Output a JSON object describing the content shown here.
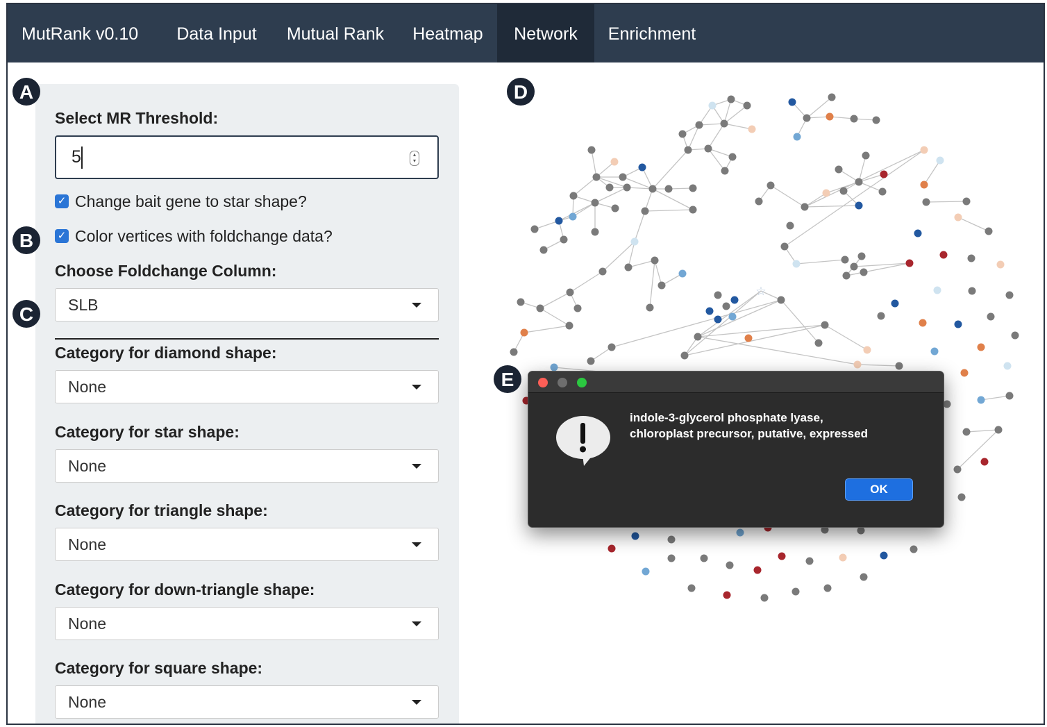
{
  "navbar": {
    "brand": "MutRank v0.10",
    "items": [
      "Data Input",
      "Mutual Rank",
      "Heatmap",
      "Network",
      "Enrichment"
    ],
    "active": "Network"
  },
  "sidebar": {
    "threshold_label": "Select MR Threshold:",
    "threshold_value": "5",
    "checkbox_star": {
      "label": "Change bait gene to star shape?",
      "checked": true
    },
    "checkbox_color": {
      "label": "Color vertices with foldchange data?",
      "checked": true
    },
    "foldchange_label": "Choose Foldchange Column:",
    "foldchange_value": "SLB",
    "diamond_label": "Category for diamond shape:",
    "diamond_value": "None",
    "star_label": "Category for star shape:",
    "star_value": "None",
    "triangle_label": "Category for triangle shape:",
    "triangle_value": "None",
    "downtriangle_label": "Category for down-triangle shape:",
    "downtriangle_value": "None",
    "square_label": "Category for square shape:",
    "square_value": "None"
  },
  "badges": {
    "a": "A",
    "b": "B",
    "c": "C",
    "d": "D",
    "e": "E"
  },
  "dialog": {
    "message_line1": "indole-3-glycerol phosphate lyase,",
    "message_line2": "chloroplast precursor, putative, expressed",
    "ok_label": "OK"
  },
  "colors": {
    "navbar": "#2e3d4f",
    "navbar_active": "#1f2a38",
    "node_gray": "#7a7a7a",
    "node_dark_blue": "#2258a0",
    "node_light_blue": "#72a7d4",
    "node_pale_blue": "#cfe3f0",
    "node_dark_red": "#a8262d",
    "node_orange": "#e0804a",
    "node_pale_orange": "#f3cdb5",
    "edge": "#c4c4c4"
  }
}
